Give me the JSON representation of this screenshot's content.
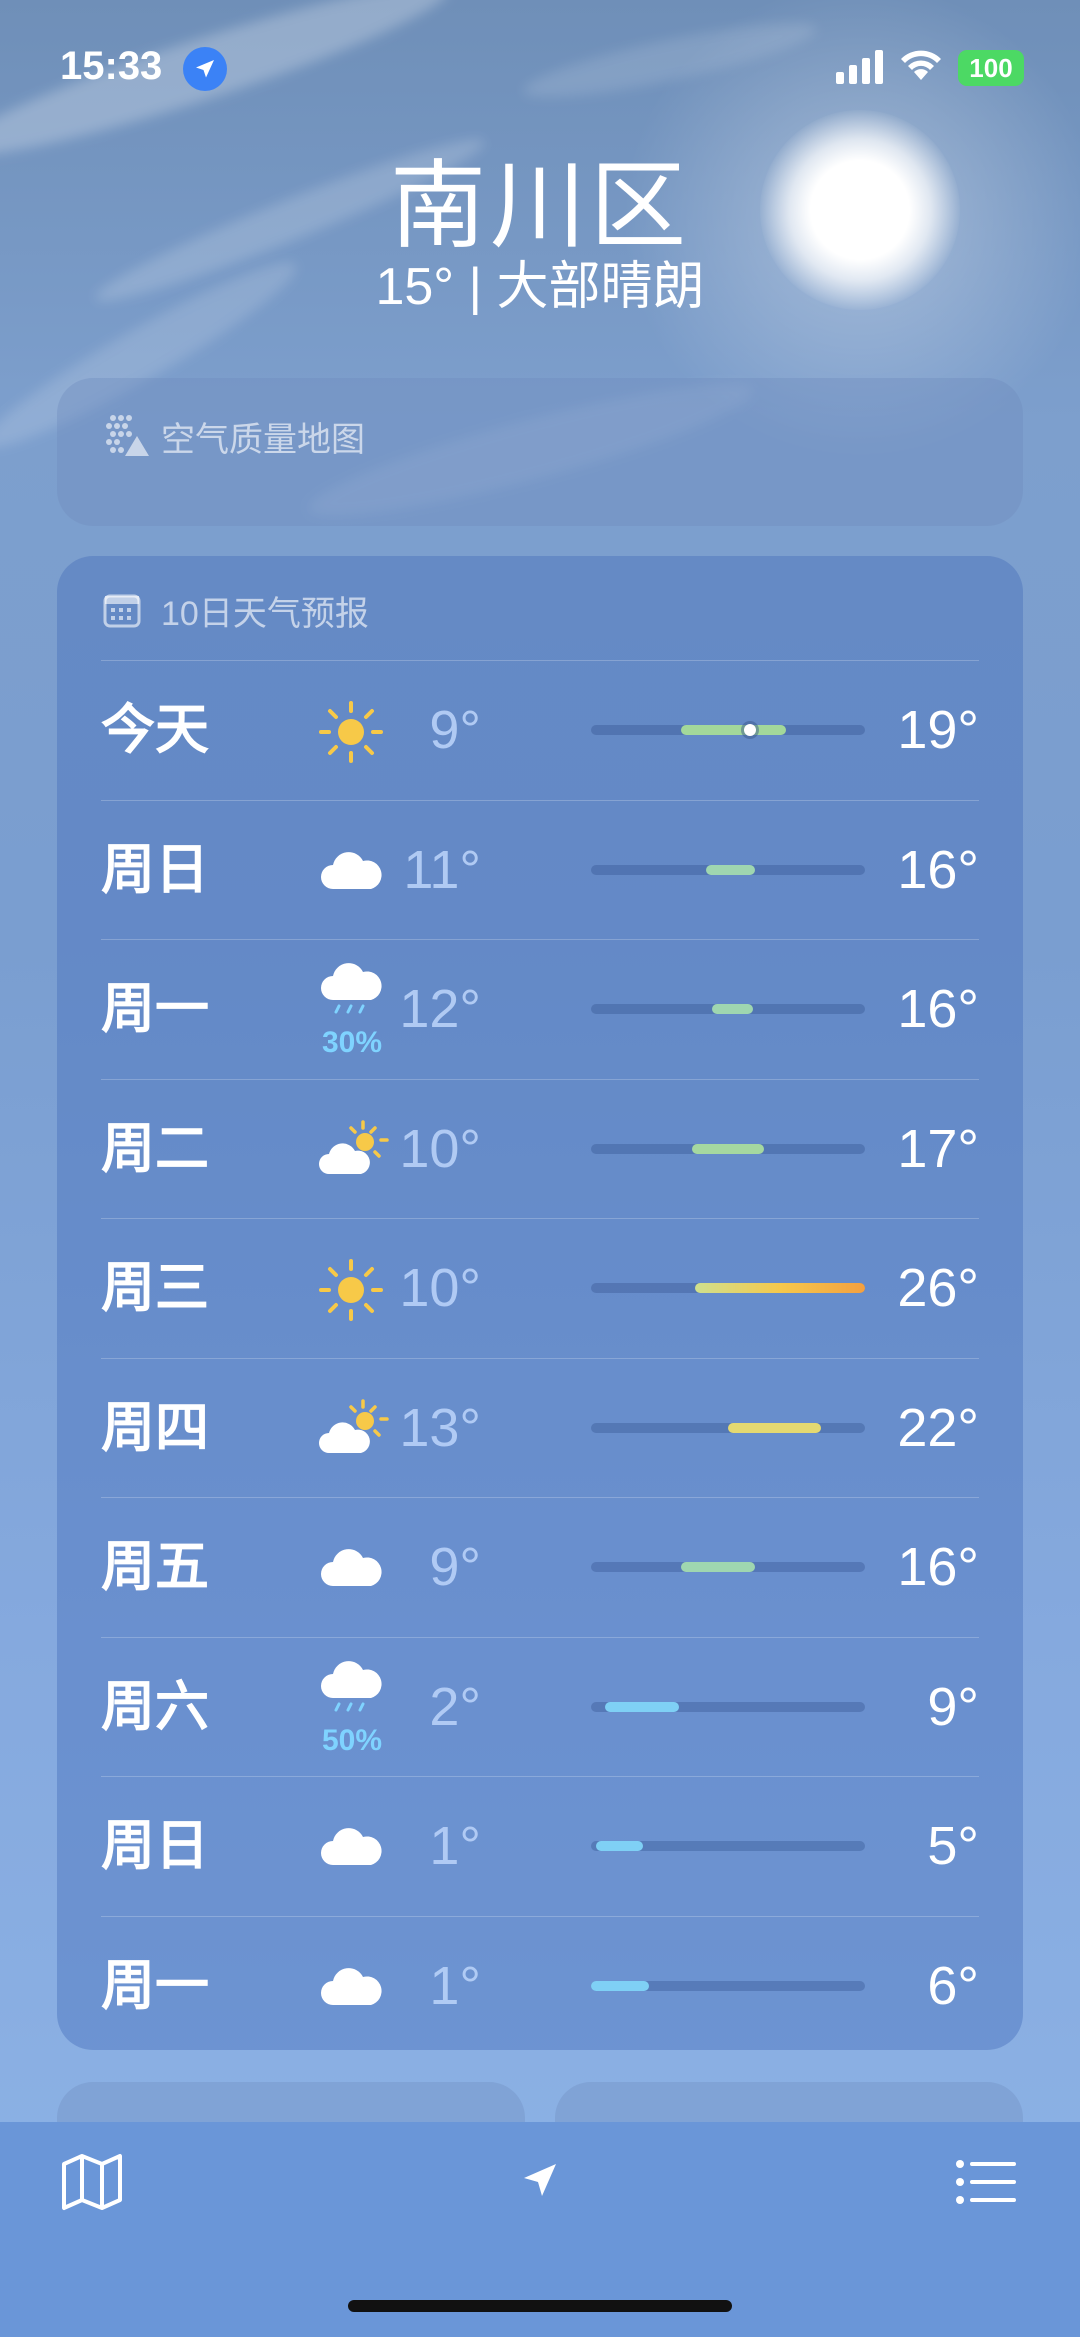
{
  "status_bar": {
    "time": "15:33",
    "battery": "100"
  },
  "location": {
    "city": "南川区",
    "summary": "15° | 大部晴朗"
  },
  "air_quality_card": {
    "title": "空气质量地图",
    "icon": "air-quality-map-icon"
  },
  "forecast": {
    "title": "10日天气预报",
    "icon": "calendar-icon",
    "days": [
      {
        "day": "今天",
        "icon": "sun-icon",
        "precip": "",
        "low": "9°",
        "high": "19°",
        "range_start": 0.33,
        "range_end": 0.71,
        "current": 0.58,
        "color": "#a3d89a"
      },
      {
        "day": "周日",
        "icon": "cloud-icon",
        "precip": "",
        "low": "11°",
        "high": "16°",
        "range_start": 0.42,
        "range_end": 0.6,
        "color": "#9fd6b0"
      },
      {
        "day": "周一",
        "icon": "rain-icon",
        "precip": "30%",
        "low": "12°",
        "high": "16°",
        "range_start": 0.44,
        "range_end": 0.59,
        "color": "#9fd6b0"
      },
      {
        "day": "周二",
        "icon": "partly-sunny-icon",
        "precip": "",
        "low": "10°",
        "high": "17°",
        "range_start": 0.37,
        "range_end": 0.63,
        "color": "#a5d8a0"
      },
      {
        "day": "周三",
        "icon": "sun-icon",
        "precip": "",
        "low": "10°",
        "high": "26°",
        "range_start": 0.38,
        "range_end": 1.0,
        "color": "linear-gradient(90deg,#cfe08e,#f5c84c,#f4a040)"
      },
      {
        "day": "周四",
        "icon": "partly-sunny-icon",
        "precip": "",
        "low": "13°",
        "high": "22°",
        "range_start": 0.5,
        "range_end": 0.84,
        "color": "#e4d971"
      },
      {
        "day": "周五",
        "icon": "cloud-icon",
        "precip": "",
        "low": "9°",
        "high": "16°",
        "range_start": 0.33,
        "range_end": 0.6,
        "color": "#9fd6b0"
      },
      {
        "day": "周六",
        "icon": "rain-icon",
        "precip": "50%",
        "low": "2°",
        "high": "9°",
        "range_start": 0.05,
        "range_end": 0.32,
        "color": "#7fd0f5"
      },
      {
        "day": "周日",
        "icon": "cloud-icon",
        "precip": "",
        "low": "1°",
        "high": "5°",
        "range_start": 0.02,
        "range_end": 0.19,
        "color": "#7fd0f5"
      },
      {
        "day": "周一",
        "icon": "cloud-icon",
        "precip": "",
        "low": "1°",
        "high": "6°",
        "range_start": 0.0,
        "range_end": 0.21,
        "color": "#7fd0f5"
      }
    ]
  },
  "tab_bar": {
    "items": [
      "map-icon",
      "location-arrow-icon",
      "list-icon"
    ]
  }
}
